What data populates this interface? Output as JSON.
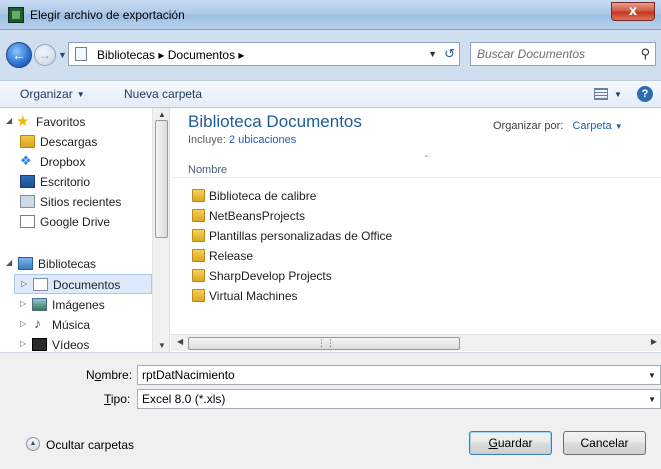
{
  "window": {
    "title": "Elegir archivo de exportación",
    "close_glyph": "x"
  },
  "address_bar": {
    "path": "Bibliotecas ▸ Documentos ▸",
    "search_placeholder": "Buscar Documentos"
  },
  "toolbar": {
    "organize_label": "Organizar",
    "new_folder_label": "Nueva carpeta"
  },
  "nav_pane": {
    "favorites_label": "Favoritos",
    "favorites": [
      {
        "label": "Descargas",
        "icon": "downloads-folder-icon"
      },
      {
        "label": "Dropbox",
        "icon": "dropbox-icon"
      },
      {
        "label": "Escritorio",
        "icon": "desktop-icon"
      },
      {
        "label": "Sitios recientes",
        "icon": "recent-places-icon"
      },
      {
        "label": "Google Drive",
        "icon": "google-drive-icon"
      }
    ],
    "libraries_label": "Bibliotecas",
    "libraries": [
      {
        "label": "Documentos",
        "icon": "documents-library-icon",
        "selected": true
      },
      {
        "label": "Imágenes",
        "icon": "pictures-library-icon",
        "selected": false
      },
      {
        "label": "Música",
        "icon": "music-library-icon",
        "selected": false
      },
      {
        "label": "Vídeos",
        "icon": "videos-library-icon",
        "selected": false
      }
    ]
  },
  "content": {
    "library_title": "Biblioteca Documentos",
    "includes_prefix": "Incluye:",
    "includes_link": "2 ubicaciones",
    "arrange_by_label": "Organizar por:",
    "arrange_by_value": "Carpeta",
    "column_name": "Nombre",
    "items": [
      "Biblioteca de calibre",
      "NetBeansProjects",
      "Plantillas personalizadas de Office",
      "Release",
      "SharpDevelop Projects",
      "Virtual Machines"
    ]
  },
  "form": {
    "name_label_prefix": "N",
    "name_label_accel": "o",
    "name_label_rest": "mbre:",
    "name_value": "rptDatNacimiento",
    "type_label_accel": "T",
    "type_label_rest": "ipo:",
    "type_value": "Excel 8.0 (*.xls)"
  },
  "footer": {
    "hide_folders_label": "Ocultar carpetas",
    "save_accel": "G",
    "save_rest": "uardar",
    "cancel_label": "Cancelar"
  },
  "colors": {
    "accent_link": "#1e5fb4",
    "title_blue": "#1e5b95",
    "selection": "#ddeafb"
  }
}
